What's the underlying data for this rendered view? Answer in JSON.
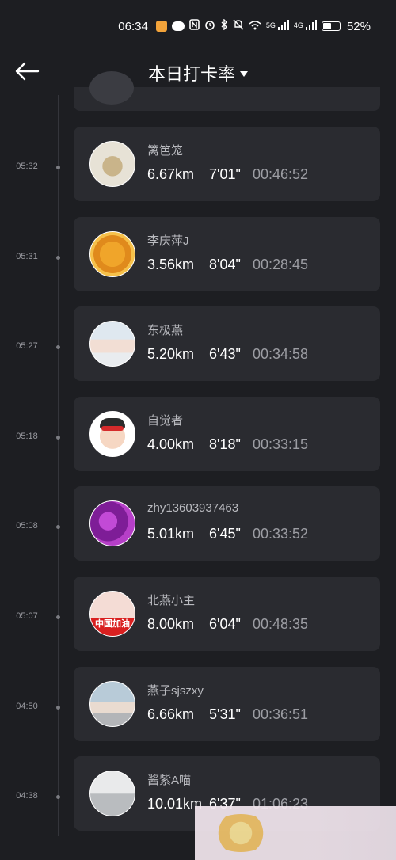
{
  "status_bar": {
    "time": "06:34",
    "battery_percent": "52%",
    "battery_level": 0.52,
    "network_labels": [
      "5G",
      "4G"
    ],
    "icons": [
      "app-badge-icon",
      "wechat-icon",
      "nfc-icon",
      "alarm-icon",
      "bluetooth-icon",
      "mute-icon",
      "wifi-icon",
      "signal-icon",
      "signal-icon",
      "battery-icon"
    ]
  },
  "header": {
    "title": "本日打卡率",
    "back_icon": "arrow-left-icon",
    "dropdown_icon": "caret-down-icon"
  },
  "entries": [
    {
      "time": "05:32",
      "name": "篱笆笼",
      "distance": "6.67km",
      "pace": "7'01\"",
      "duration": "00:46:52",
      "avatar": "lion-statue"
    },
    {
      "time": "05:31",
      "name": "李庆萍J",
      "distance": "3.56km",
      "pace": "8'04\"",
      "duration": "00:28:45",
      "avatar": "sunflower"
    },
    {
      "time": "05:27",
      "name": "东极燕",
      "distance": "5.20km",
      "pace": "6'43\"",
      "duration": "00:34:58",
      "avatar": "girl-photo"
    },
    {
      "time": "05:18",
      "name": "自觉者",
      "distance": "4.00km",
      "pace": "8'18\"",
      "duration": "00:33:15",
      "avatar": "cartoon-face"
    },
    {
      "time": "05:08",
      "name": "zhy13603937463",
      "distance": "5.01km",
      "pace": "6'45\"",
      "duration": "00:33:52",
      "avatar": "purple-flower"
    },
    {
      "time": "05:07",
      "name": "北燕小主",
      "distance": "8.00km",
      "pace": "6'04\"",
      "duration": "00:48:35",
      "avatar": "selfie",
      "avatar_text": "中国加油"
    },
    {
      "time": "04:50",
      "name": "燕子sjszxy",
      "distance": "6.66km",
      "pace": "5'31\"",
      "duration": "00:36:51",
      "avatar": "runner-photo"
    },
    {
      "time": "04:38",
      "name": "酱紫A喵",
      "distance": "10.01km",
      "pace": "6'37\"",
      "duration": "01:06:23",
      "avatar": "building-photo"
    }
  ]
}
